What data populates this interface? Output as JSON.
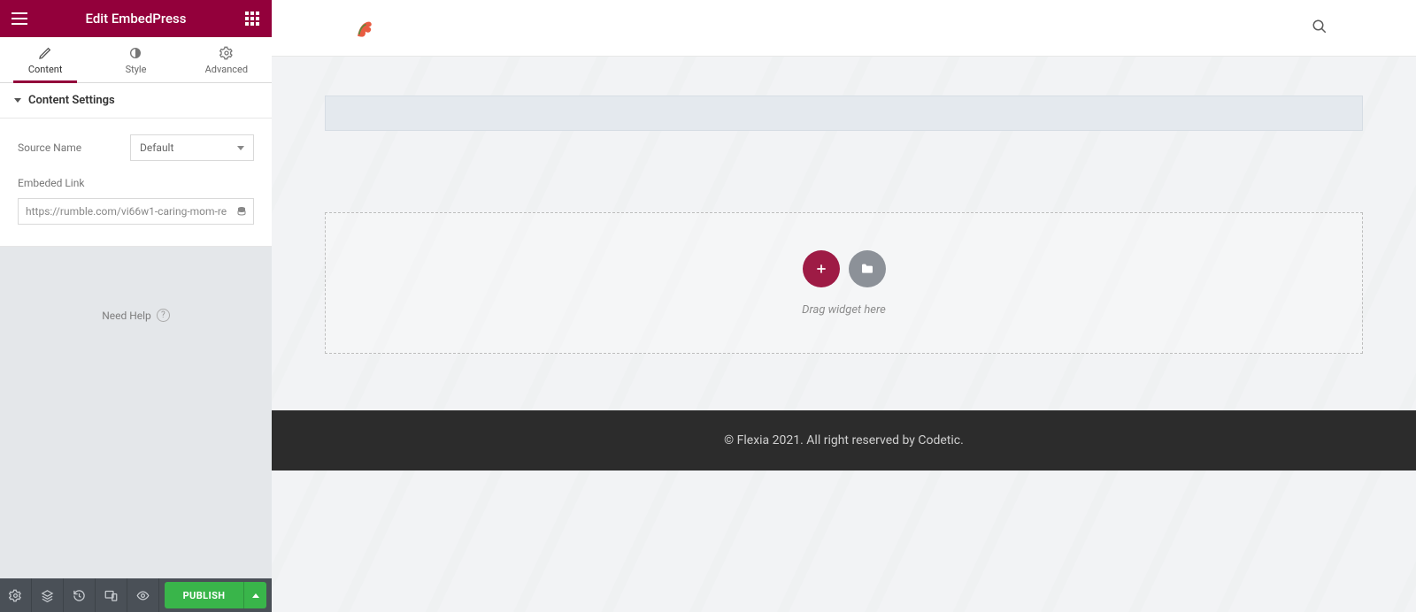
{
  "panel": {
    "title": "Edit EmbedPress",
    "tabs": [
      {
        "label": "Content"
      },
      {
        "label": "Style"
      },
      {
        "label": "Advanced"
      }
    ],
    "section_title": "Content Settings",
    "source_label": "Source Name",
    "source_value": "Default",
    "link_label": "Embeded Link",
    "link_value": "https://rumble.com/vi66w1-caring-mom-re",
    "need_help": "Need Help",
    "publish": "PUBLISH"
  },
  "canvas": {
    "drop_hint": "Drag widget here"
  },
  "footer": {
    "text": "© Flexia 2021. All right reserved by Codetic."
  }
}
